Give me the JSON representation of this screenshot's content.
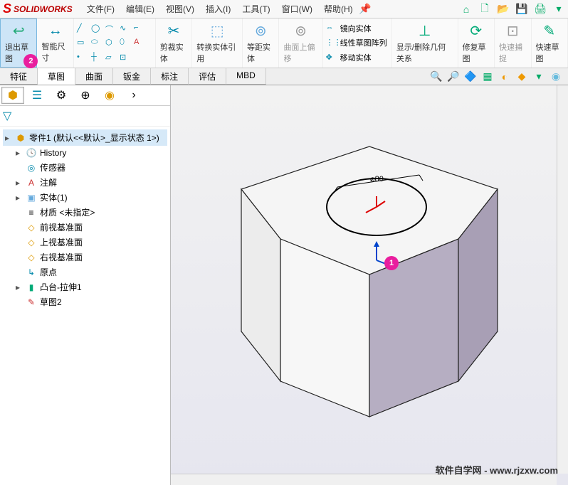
{
  "app": {
    "title": "SOLIDWORKS"
  },
  "menu": {
    "file": "文件(F)",
    "edit": "编辑(E)",
    "view": "视图(V)",
    "insert": "插入(I)",
    "tools": "工具(T)",
    "window": "窗口(W)",
    "help": "帮助(H)"
  },
  "ribbon": {
    "exit_sketch": "退出草图",
    "smart_dim": "智能尺寸",
    "trim": "剪裁实体",
    "convert": "转换实体引用",
    "offset": "等距实体",
    "surface_offset": "曲面上偏移",
    "mirror": "镜向实体",
    "pattern": "线性草图阵列",
    "move": "移动实体",
    "display_del": "显示/删除几何关系",
    "repair": "修复草图",
    "quick_snap": "快速捕捉",
    "rapid_sketch": "快速草图"
  },
  "tabs": {
    "feature": "特征",
    "sketch": "草图",
    "surface": "曲面",
    "sheetmetal": "钣金",
    "annot": "标注",
    "evaluate": "评估",
    "mbd": "MBD"
  },
  "tree": {
    "root": "零件1  (默认<<默认>_显示状态 1>)",
    "history": "History",
    "sensors": "传感器",
    "annotations": "注解",
    "solid_bodies": "实体(1)",
    "material": "材质 <未指定>",
    "front": "前视基准面",
    "top": "上视基准面",
    "right": "右视基准面",
    "origin": "原点",
    "extrude1": "凸台-拉伸1",
    "sketch2": "草图2"
  },
  "viewport": {
    "dimension": "⌀80",
    "annotation1": "1",
    "annotation2": "2"
  },
  "watermark": "软件自学网 - www.rjzxw.com"
}
